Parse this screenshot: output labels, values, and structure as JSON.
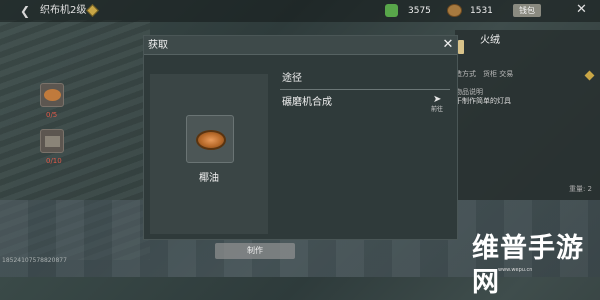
{
  "header": {
    "title": "织布机2级",
    "resource_1_value": "3575",
    "resource_2_value": "1531",
    "resource_button_label": "钱包",
    "back_icon": "chevron-left-icon",
    "close_icon": "close-icon"
  },
  "left_slots": [
    {
      "count": "0/5"
    },
    {
      "count": "0/10"
    }
  ],
  "modal": {
    "title": "获取",
    "item_name": "椰油",
    "route_header": "途径",
    "routes": [
      {
        "label": "碾磨机合成",
        "action_label": "前往"
      }
    ]
  },
  "right_panel": {
    "title": "火绒",
    "line1": "造方式　货柜 交易",
    "line2": "物品说明",
    "line3": "于制作简单的灯具",
    "weight": "重量: 2"
  },
  "footer": {
    "make_button": "制作",
    "player_id": "18524107578820877"
  },
  "watermark": {
    "text": "维普手游网",
    "url": "www.wepu.cn"
  },
  "colors": {
    "accent_gold": "#c9a646",
    "count_red": "#e05a4a"
  }
}
